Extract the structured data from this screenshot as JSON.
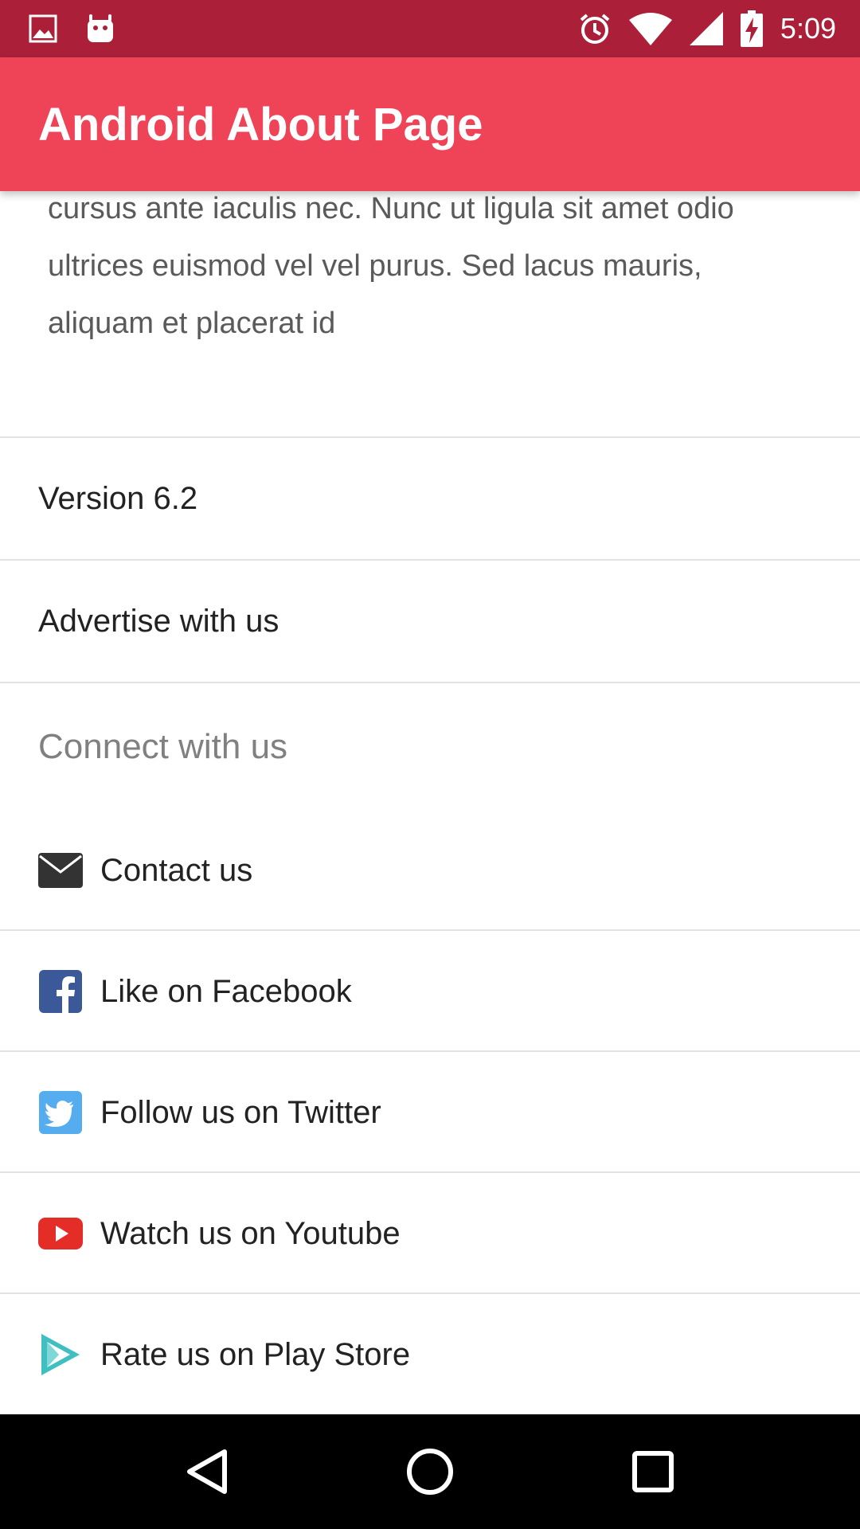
{
  "status_bar": {
    "time": "5:09",
    "left_icons": [
      "gallery-icon",
      "android-icon"
    ],
    "right_icons": [
      "alarm-icon",
      "wifi-icon",
      "cell-signal-icon",
      "battery-charging-icon"
    ],
    "background": "#ab2038"
  },
  "app_bar": {
    "title": "Android About Page",
    "background": "#ef4358"
  },
  "description": {
    "text": "cursus ante iaculis nec. Nunc ut ligula sit amet odio ultrices euismod vel vel purus. Sed lacus mauris, aliquam et placerat id"
  },
  "items": {
    "version": "Version 6.2",
    "advertise": "Advertise with us"
  },
  "connect": {
    "header": "Connect with us",
    "items": [
      {
        "label": "Contact us",
        "icon": "email-icon",
        "color": "#333333"
      },
      {
        "label": "Like on Facebook",
        "icon": "facebook-icon",
        "color": "#3b5998"
      },
      {
        "label": "Follow us on Twitter",
        "icon": "twitter-icon",
        "color": "#55acee"
      },
      {
        "label": "Watch us on Youtube",
        "icon": "youtube-icon",
        "color": "#e52d27"
      },
      {
        "label": "Rate us on Play Store",
        "icon": "play-store-icon",
        "color": "#3fbfbf"
      }
    ]
  },
  "nav_bar": {
    "buttons": [
      "back-icon",
      "home-icon",
      "recents-icon"
    ]
  }
}
